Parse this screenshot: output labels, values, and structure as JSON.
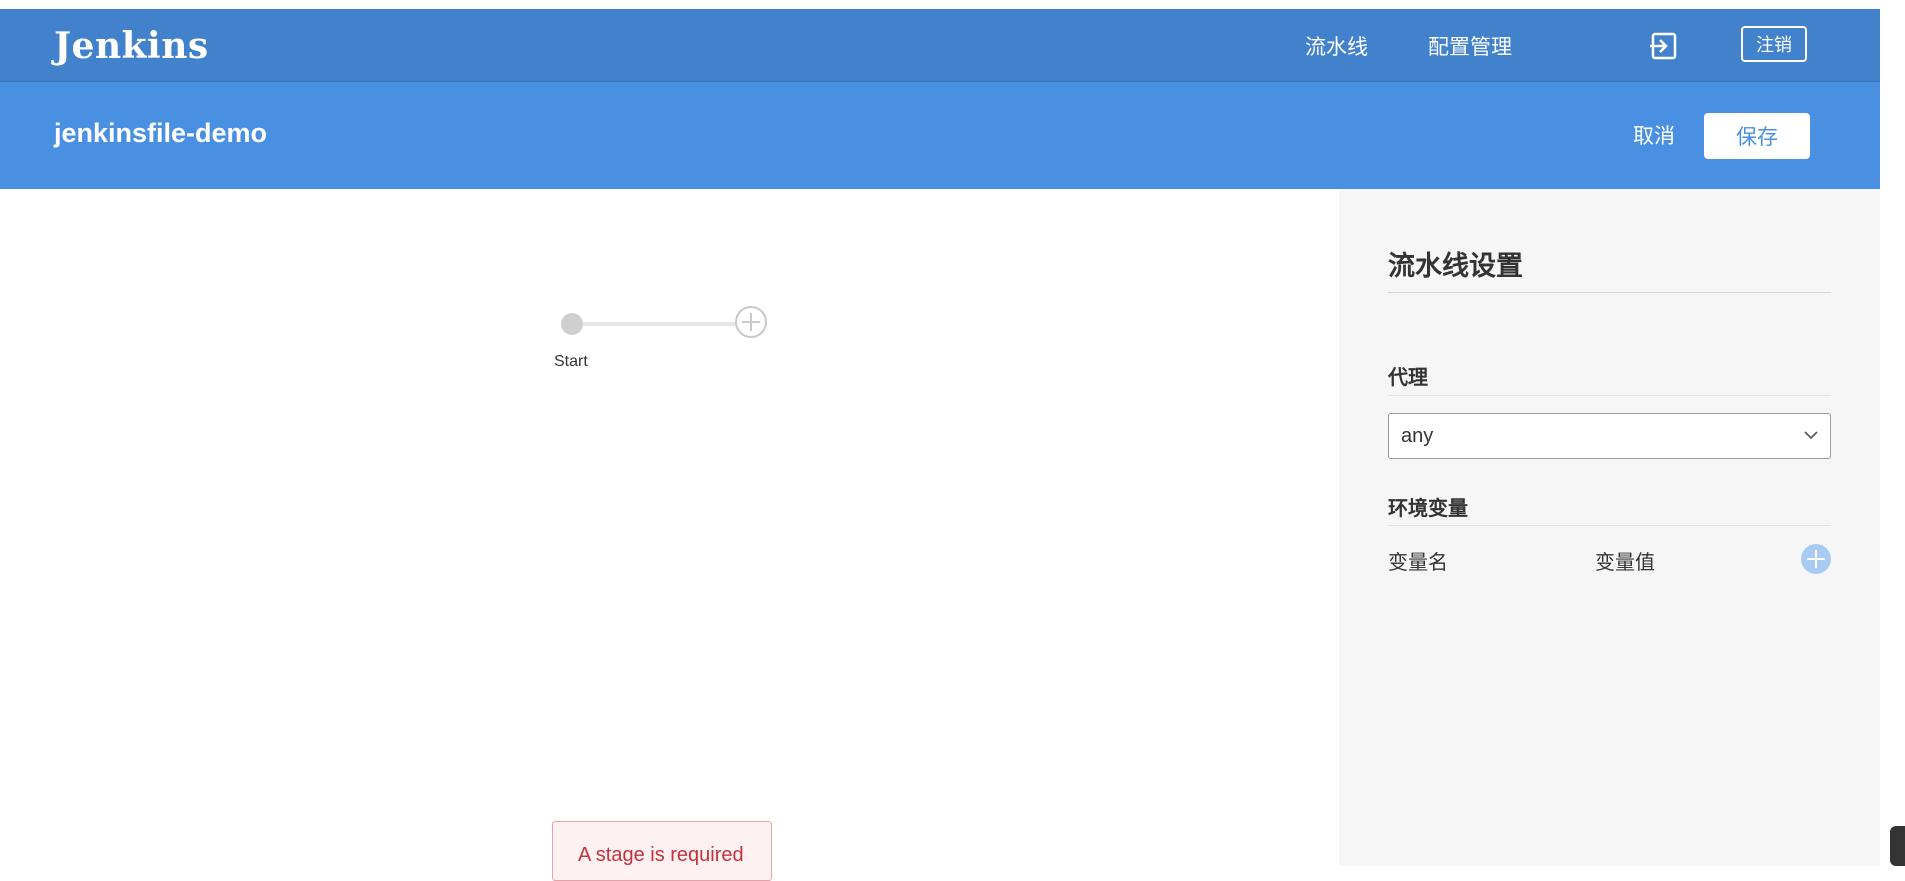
{
  "app": {
    "logo": "Jenkins"
  },
  "nav": {
    "items": [
      {
        "label": "流水线"
      },
      {
        "label": "配置管理"
      }
    ],
    "logout_label": "注销"
  },
  "editor": {
    "pipeline_name": "jenkinsfile-demo",
    "cancel_label": "取消",
    "save_label": "保存"
  },
  "graph": {
    "start_label": "Start",
    "error_message": "A stage is required"
  },
  "settings": {
    "title": "流水线设置",
    "agent": {
      "label": "代理",
      "value": "any"
    },
    "environment": {
      "label": "环境变量",
      "name_header": "变量名",
      "value_header": "变量值"
    }
  },
  "icons": {
    "logout": "logout-icon",
    "add_stage": "plus-circle-icon",
    "add_env": "plus-circle-icon",
    "select": "chevron-down-icon"
  },
  "colors": {
    "appbar": "#4282cc",
    "subbar": "#4a90e2",
    "error": "#c4323e",
    "sidebar": "#f6f6f6"
  }
}
